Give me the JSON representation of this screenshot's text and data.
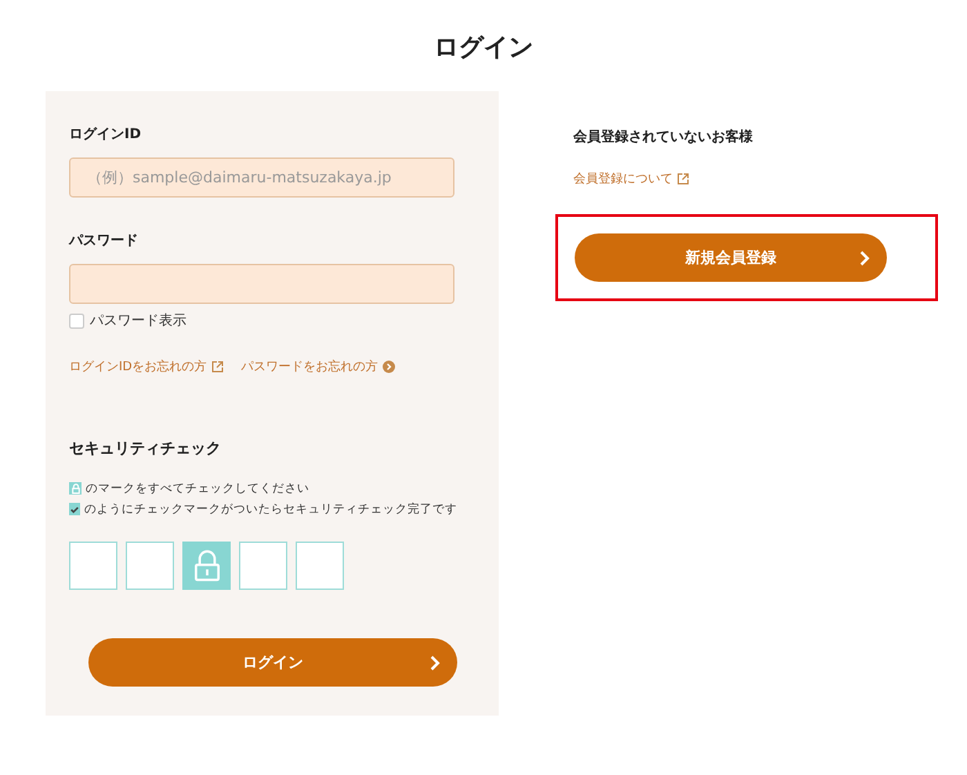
{
  "title": "ログイン",
  "login": {
    "id_label": "ログインID",
    "id_placeholder": "（例）sample@daimaru-matsuzakaya.jp",
    "password_label": "パスワード",
    "show_password": {
      "label": "パスワード表示",
      "checked": false
    },
    "links": [
      {
        "label": "ログインIDをお忘れの方",
        "kind": "external"
      },
      {
        "label": "パスワードをお忘れの方",
        "kind": "arrow"
      }
    ],
    "security": {
      "heading": "セキュリティチェック",
      "instructions": [
        {
          "text": "のマークをすべてチェックしてください",
          "kind": "lock"
        },
        {
          "text": "のようにチェックマークがついたらセキュリティチェック完了です",
          "kind": "check"
        }
      ],
      "tiles": [
        {
          "selected": false
        },
        {
          "selected": false
        },
        {
          "selected": true
        },
        {
          "selected": false
        },
        {
          "selected": false
        }
      ]
    },
    "submit": "ログイン"
  },
  "register": {
    "heading": "会員登録されていないお客様",
    "link": "会員登録について",
    "button": "新規会員登録",
    "highlighted": true
  }
}
